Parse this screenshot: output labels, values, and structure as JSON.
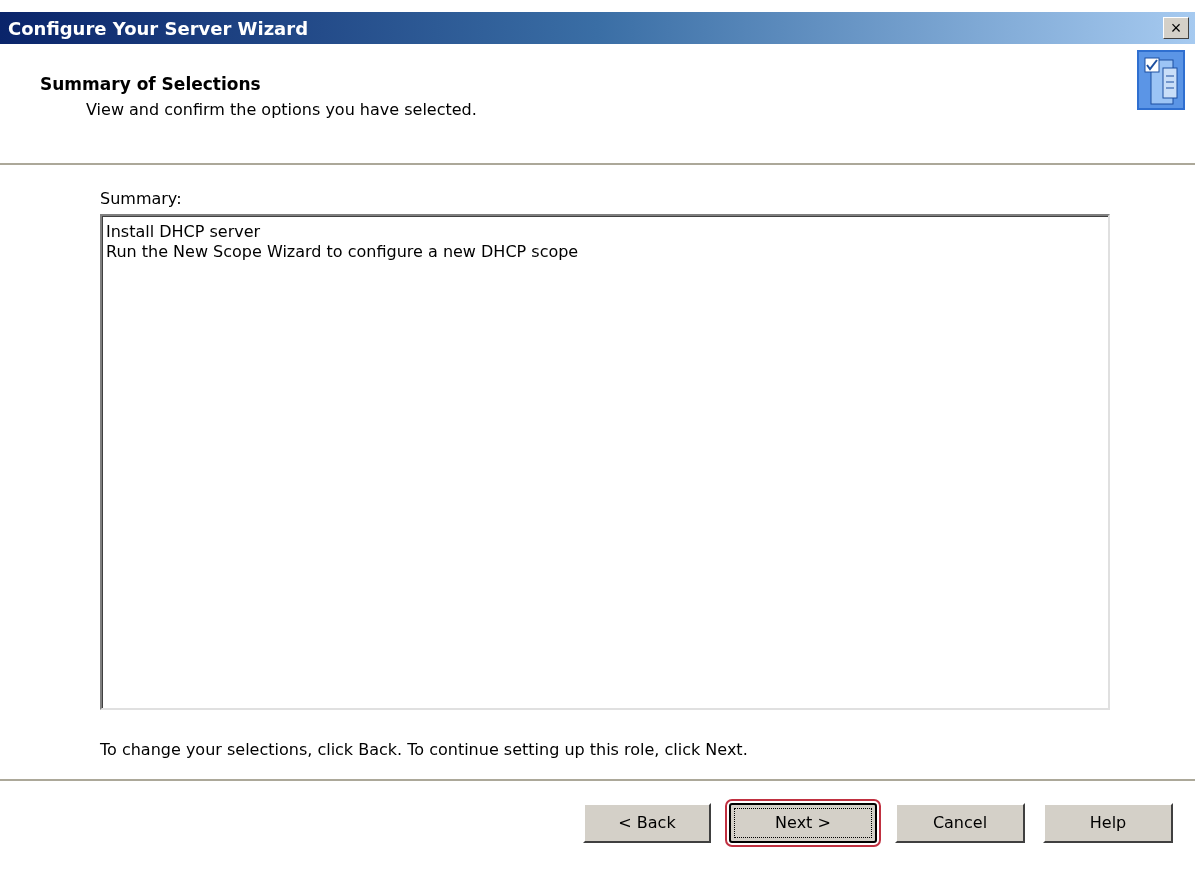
{
  "window": {
    "title": "Configure Your Server Wizard",
    "close": "×"
  },
  "header": {
    "title": "Summary of Selections",
    "subtitle": "View and confirm the options you have selected."
  },
  "summary": {
    "label": "Summary:",
    "lines": [
      "Install DHCP server",
      "Run the New Scope Wizard to configure a new DHCP scope"
    ]
  },
  "instruction": "To change your selections, click Back. To continue setting up this role, click Next.",
  "buttons": [
    {
      "label": "< Back",
      "focused": false,
      "highlighted": false
    },
    {
      "label": "Next >",
      "focused": true,
      "highlighted": true
    },
    {
      "label": "Cancel",
      "focused": false,
      "highlighted": false
    },
    {
      "label": "Help",
      "focused": false,
      "highlighted": false
    }
  ]
}
